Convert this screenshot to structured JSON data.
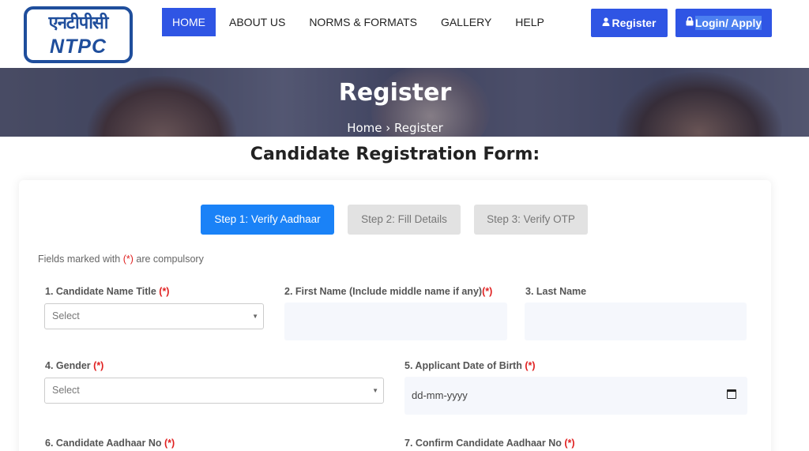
{
  "logo": {
    "hindi": "एनटीपीसी",
    "english": "NTPC"
  },
  "nav": {
    "items": [
      "HOME",
      "ABOUT US",
      "NORMS & FORMATS",
      "GALLERY",
      "HELP"
    ],
    "register_label": "Register",
    "login_label": "Login/ Apply"
  },
  "banner": {
    "title": "Register",
    "breadcrumb_home": "Home",
    "breadcrumb_sep": "›",
    "breadcrumb_current": "Register"
  },
  "form": {
    "title": "Candidate Registration Form:",
    "steps": [
      "Step 1: Verify Aadhaar",
      "Step 2: Fill Details",
      "Step 3: Verify OTP"
    ],
    "note_prefix": "Fields marked with",
    "note_req": "(*)",
    "note_suffix": "are compulsory",
    "required_mark": "(*)",
    "fields": {
      "name_title": {
        "label": "1. Candidate Name Title",
        "placeholder": "Select"
      },
      "first_name": {
        "label": "2. First Name (Include middle name if any)"
      },
      "last_name": {
        "label": "3. Last Name"
      },
      "gender": {
        "label": "4. Gender",
        "placeholder": "Select"
      },
      "dob": {
        "label": "5. Applicant Date of Birth",
        "placeholder": "dd-mm-yyyy"
      },
      "aadhaar": {
        "label": "6. Candidate Aadhaar No"
      },
      "confirm_aadhaar": {
        "label": "7. Confirm Candidate Aadhaar No"
      }
    }
  },
  "colors": {
    "primary": "#2f55e4",
    "step_active": "#1a82f7",
    "step_inactive": "#e2e2e2",
    "required": "#e02020",
    "logo_blue": "#1f4e9c"
  }
}
